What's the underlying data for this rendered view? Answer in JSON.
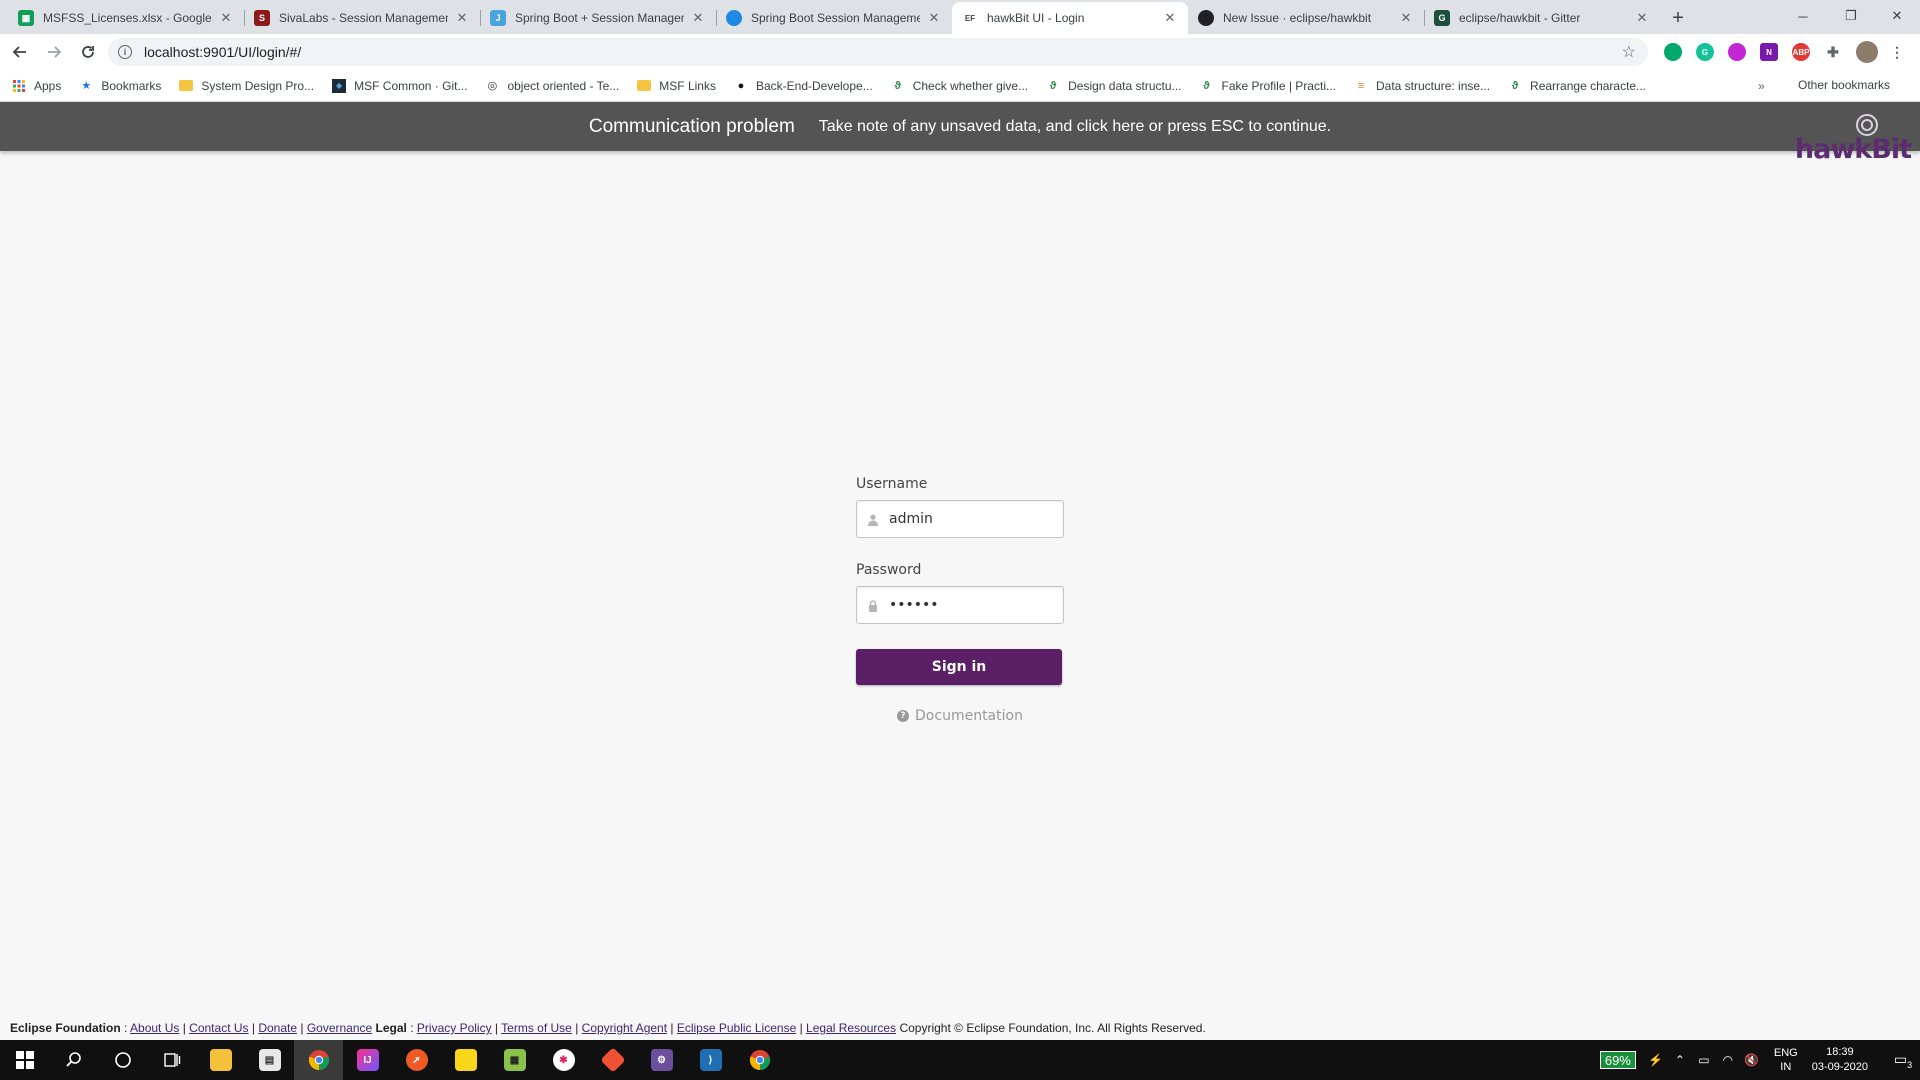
{
  "browser": {
    "tabs": [
      {
        "title": "MSFSS_Licenses.xlsx - Google Sheets",
        "color": "#0f9d58",
        "glyph": "▦"
      },
      {
        "title": "SivaLabs - Session Management",
        "color": "#8b1a1a",
        "glyph": "S"
      },
      {
        "title": "Spring Boot + Session Management",
        "color": "#4aa3df",
        "glyph": "J"
      },
      {
        "title": "Spring Boot Session Management",
        "color": "#1e88e5",
        "glyph": "●"
      },
      {
        "title": "hawkBit UI - Login",
        "color": "#ffffff",
        "glyph": "EF"
      },
      {
        "title": "New Issue · eclipse/hawkbit",
        "color": "#202124",
        "glyph": "◉"
      },
      {
        "title": "eclipse/hawkbit - Gitter",
        "color": "#1d4f3f",
        "glyph": "G"
      }
    ],
    "url": "localhost:9901/UI/login/#/"
  },
  "bookmarks": {
    "items": [
      {
        "label": "Apps",
        "icon": "apps-icon"
      },
      {
        "label": "Bookmarks",
        "icon": "star-icon"
      },
      {
        "label": "System Design Pro...",
        "icon": "folder-icon"
      },
      {
        "label": "MSF Common · Git...",
        "icon": "azure-icon"
      },
      {
        "label": "object oriented - Te...",
        "icon": "globe-icon"
      },
      {
        "label": "MSF Links",
        "icon": "folder-icon"
      },
      {
        "label": "Back-End-Develope...",
        "icon": "github-icon"
      },
      {
        "label": "Check whether give...",
        "icon": "geeks-icon"
      },
      {
        "label": "Design data structu...",
        "icon": "geeks-icon"
      },
      {
        "label": "Fake Profile | Practi...",
        "icon": "geeks-icon"
      },
      {
        "label": "Data structure: inse...",
        "icon": "stackoverflow-icon"
      },
      {
        "label": "Rearrange characte...",
        "icon": "geeks-icon"
      }
    ],
    "more": "»",
    "other": "Other bookmarks"
  },
  "notification": {
    "title": "Communication problem",
    "message": "Take note of any unsaved data, and click here or press ESC to continue."
  },
  "logo": {
    "text": "hawkBit"
  },
  "login": {
    "username_label": "Username",
    "username_value": "admin",
    "password_label": "Password",
    "password_value": "••••••",
    "signin_label": "Sign in",
    "documentation_label": "Documentation"
  },
  "footer": {
    "org": "Eclipse Foundation",
    "links1": [
      "About Us",
      "Contact Us",
      "Donate",
      "Governance"
    ],
    "legal": "Legal",
    "links2": [
      "Privacy Policy",
      "Terms of Use",
      "Copyright Agent",
      "Eclipse Public License",
      "Legal Resources"
    ],
    "copyright": "Copyright © Eclipse Foundation, Inc. All Rights Reserved."
  },
  "taskbar": {
    "battery": "69%",
    "lang_top": "ENG",
    "lang_bottom": "IN",
    "time": "18:39",
    "date": "03-09-2020",
    "notifications": "3"
  },
  "colors": {
    "accent": "#5b1f66",
    "notification_bg": "#545454"
  }
}
